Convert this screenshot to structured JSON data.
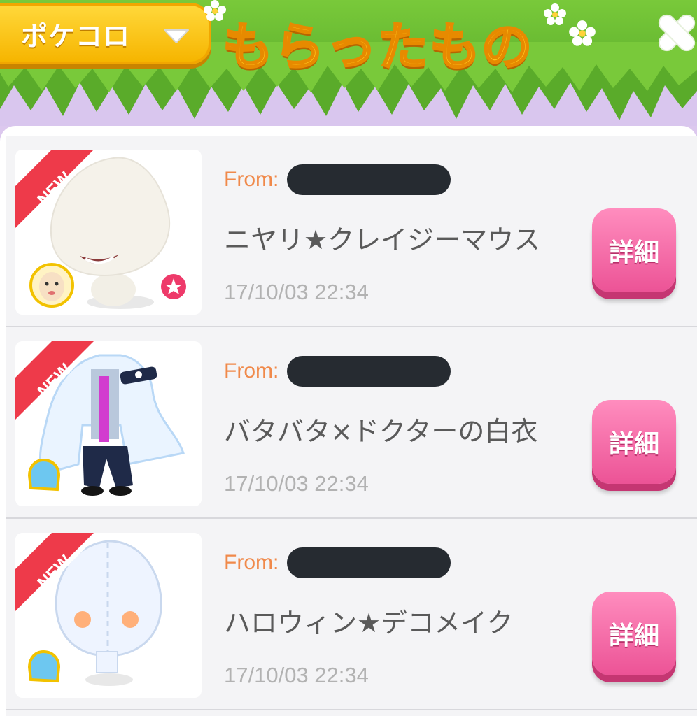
{
  "header": {
    "category_select": "ポケコロ",
    "title": "もらったもの"
  },
  "gifts": [
    {
      "from_label": "From:",
      "badge": "NEW",
      "name": "ニヤリ★クレイジーマウス",
      "date": "17/10/03 22:34",
      "category_icon": "face-icon",
      "detail_label": "詳細"
    },
    {
      "from_label": "From:",
      "badge": "NEW",
      "name": "バタバタ×ドクターの白衣",
      "date": "17/10/03 22:34",
      "category_icon": "clothing-icon",
      "detail_label": "詳細"
    },
    {
      "from_label": "From:",
      "badge": "NEW",
      "name": "ハロウィン★デコメイク",
      "date": "17/10/03 22:34",
      "category_icon": "clothing-icon",
      "detail_label": "詳細"
    }
  ],
  "colors": {
    "from_label": "#f0894a",
    "detail_button": "#ec5396",
    "new_ribbon": "#ee3a4a",
    "title": "#ffc61c"
  }
}
